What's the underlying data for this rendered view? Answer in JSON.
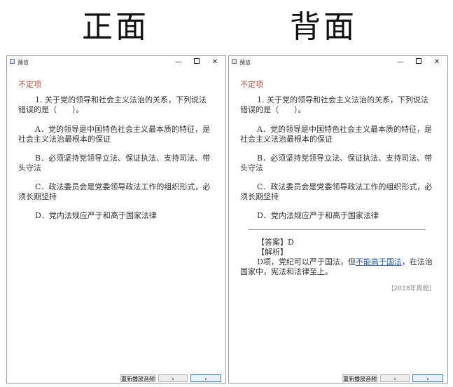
{
  "headings": {
    "front": "正面",
    "back": "背面"
  },
  "window": {
    "title": "预览",
    "minimize": "—",
    "close": "✕"
  },
  "question": {
    "type": "不定项",
    "stem": "1. 关于党的领导和社会主义法治的关系，下列说法错误的是（　　）。",
    "options": [
      "A．党的领导是中国特色社会主义最本质的特征，是社会主义法治最根本的保证",
      "B．必须坚持党领导立法、保证执法、支持司法、带头守法",
      "C．政法委员会是党委领导政法工作的组织形式，必须长期坚持",
      "D．党内法规应严于和高于国家法律"
    ]
  },
  "answer": {
    "answer_line": "【答案】D",
    "analysis_label": "【解析】",
    "explanation_before": "D项，党纪可以严于国法，但",
    "explanation_link": "不能高于国法",
    "explanation_after": "，在法治国家中，宪法和法律至上。",
    "source": "[2018年真题]"
  },
  "bottom": {
    "replay": "重新播放音频",
    "prev": "‹",
    "next": "›"
  }
}
